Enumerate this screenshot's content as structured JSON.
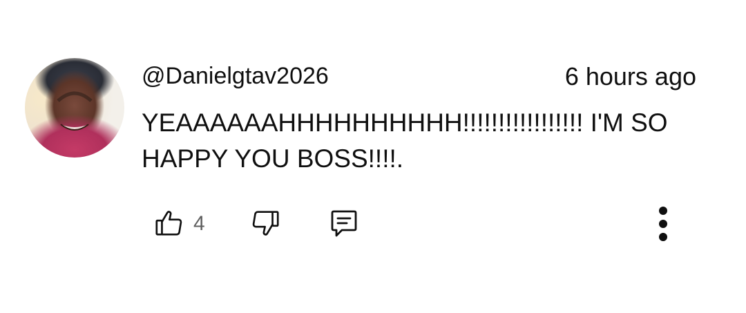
{
  "comment": {
    "author": "@Danielgtav2026",
    "time_ago": "6 hours ago",
    "text": "YEAAAAAAHHHHHHHHHH!!!!!!!!!!!!!!!!! I'M SO HAPPY YOU BOSS!!!!.",
    "likes": "4"
  },
  "icons": {
    "like": "thumbs-up-icon",
    "dislike": "thumbs-down-icon",
    "reply": "comment-icon",
    "more": "more-vertical-icon"
  },
  "colors": {
    "text": "#0f0f0f",
    "secondary_text": "#606060",
    "background": "#ffffff"
  }
}
